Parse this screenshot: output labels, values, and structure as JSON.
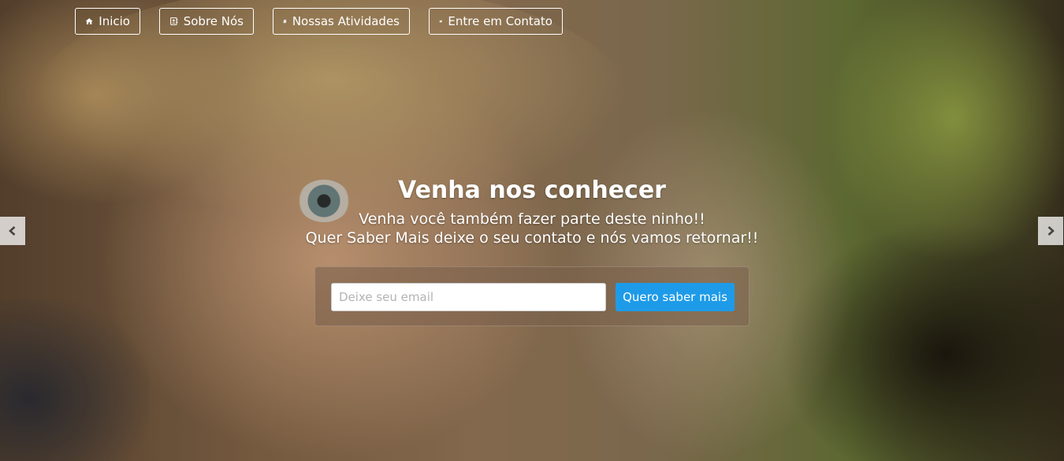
{
  "nav": {
    "items": [
      {
        "label": "Inicio",
        "icon": "home-icon"
      },
      {
        "label": "Sobre Nós",
        "icon": "address-book-icon"
      },
      {
        "label": "Nossas Atividades",
        "icon": "book-icon"
      },
      {
        "label": "Entre em Contato",
        "icon": "bullhorn-icon"
      }
    ]
  },
  "hero": {
    "title": "Venha nos conhecer",
    "subtitle_line1": "Venha você também fazer parte deste ninho!!",
    "subtitle_line2": "Quer Saber Mais deixe o seu contato e nós vamos retornar!!"
  },
  "signup": {
    "email_placeholder": "Deixe seu email",
    "email_value": "",
    "submit_label": "Quero saber mais"
  },
  "carousel": {
    "prev_icon": "chevron-left-icon",
    "next_icon": "chevron-right-icon"
  },
  "colors": {
    "accent": "#1e9be8",
    "nav_border": "#ffffff",
    "text_light": "#ffffff"
  }
}
